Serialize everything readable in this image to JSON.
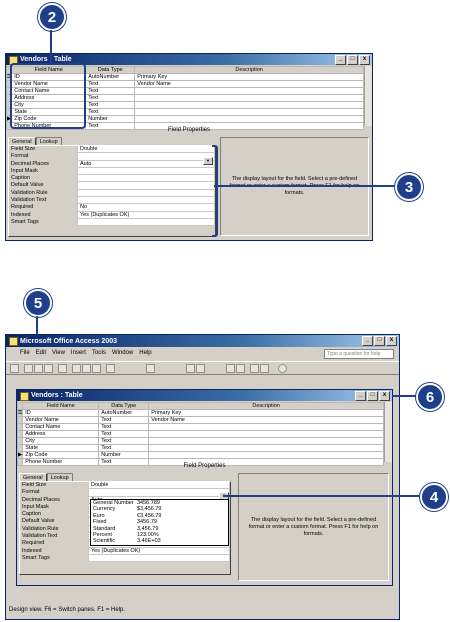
{
  "callouts": {
    "c2": "2",
    "c3": "3",
    "c5": "5",
    "c6": "6",
    "c4": "4"
  },
  "table_window": {
    "title": "Vendors : Table",
    "columns": [
      "Field Name",
      "Data Type",
      "Description"
    ],
    "rows": [
      {
        "name": "ID",
        "type": "AutoNumber",
        "desc": "Primary Key"
      },
      {
        "name": "Vendor Name",
        "type": "Text",
        "desc": "Vendor Name"
      },
      {
        "name": "Contact Name",
        "type": "Text",
        "desc": ""
      },
      {
        "name": "Address",
        "type": "Text",
        "desc": ""
      },
      {
        "name": "City",
        "type": "Text",
        "desc": ""
      },
      {
        "name": "State",
        "type": "Text",
        "desc": ""
      },
      {
        "name": "Zip Code",
        "type": "Number",
        "desc": ""
      },
      {
        "name": "Phone Number",
        "type": "Text",
        "desc": ""
      }
    ],
    "field_properties_title": "Field Properties",
    "tabs": [
      "General",
      "Lookup"
    ],
    "properties": [
      {
        "label": "Field Size",
        "value": "Double"
      },
      {
        "label": "Format",
        "value": ""
      },
      {
        "label": "Decimal Places",
        "value": "Auto"
      },
      {
        "label": "Input Mask",
        "value": ""
      },
      {
        "label": "Caption",
        "value": ""
      },
      {
        "label": "Default Value",
        "value": ""
      },
      {
        "label": "Validation Rule",
        "value": ""
      },
      {
        "label": "Validation Text",
        "value": ""
      },
      {
        "label": "Required",
        "value": "No"
      },
      {
        "label": "Indexed",
        "value": "Yes (Duplicates OK)"
      },
      {
        "label": "Smart Tags",
        "value": ""
      }
    ],
    "help_text": "The display layout for the field.  Select a pre-defined format or enter a custom format.  Press F1 for help on formats."
  },
  "app_window": {
    "title": "Microsoft Office Access 2003",
    "menu": [
      "File",
      "Edit",
      "View",
      "Insert",
      "Tools",
      "Window",
      "Help"
    ],
    "help_search_placeholder": "Type a question for help",
    "format_options": [
      {
        "name": "General Number",
        "example": "3456.789"
      },
      {
        "name": "Currency",
        "example": "$3,456.79"
      },
      {
        "name": "Euro",
        "example": "€3,456.79"
      },
      {
        "name": "Fixed",
        "example": "3456.79"
      },
      {
        "name": "Standard",
        "example": "3,456.79"
      },
      {
        "name": "Percent",
        "example": "123.00%"
      },
      {
        "name": "Scientific",
        "example": "3.46E+03"
      }
    ],
    "indexed_value_partial": "Yes (Duplicates OK)",
    "status": "Design view.  F6 = Switch panes.  F1 = Help."
  }
}
